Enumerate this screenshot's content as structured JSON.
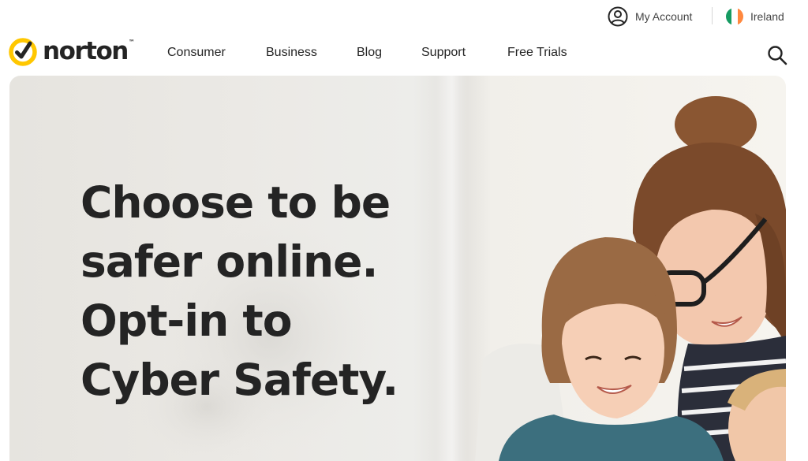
{
  "utility_bar": {
    "account_label": "My Account",
    "account_icon": "user-circle-icon",
    "region_label": "Ireland",
    "region_icon": "ireland-flag-icon"
  },
  "header": {
    "logo_text": "norton",
    "logo_icon": "norton-checkmark-icon",
    "nav_items": [
      {
        "label": "Consumer"
      },
      {
        "label": "Business"
      },
      {
        "label": "Blog"
      },
      {
        "label": "Support"
      },
      {
        "label": "Free Trials"
      }
    ],
    "search_icon": "search-icon"
  },
  "hero": {
    "headline_lines": [
      "Choose to be",
      "safer online.",
      "Opt-in to",
      "Cyber Safety."
    ],
    "image": "mother-and-children-photo"
  },
  "colors": {
    "brand_yellow": "#FFC700",
    "text_dark": "#242424",
    "flag_green": "#169B62",
    "flag_orange": "#FF883E"
  }
}
